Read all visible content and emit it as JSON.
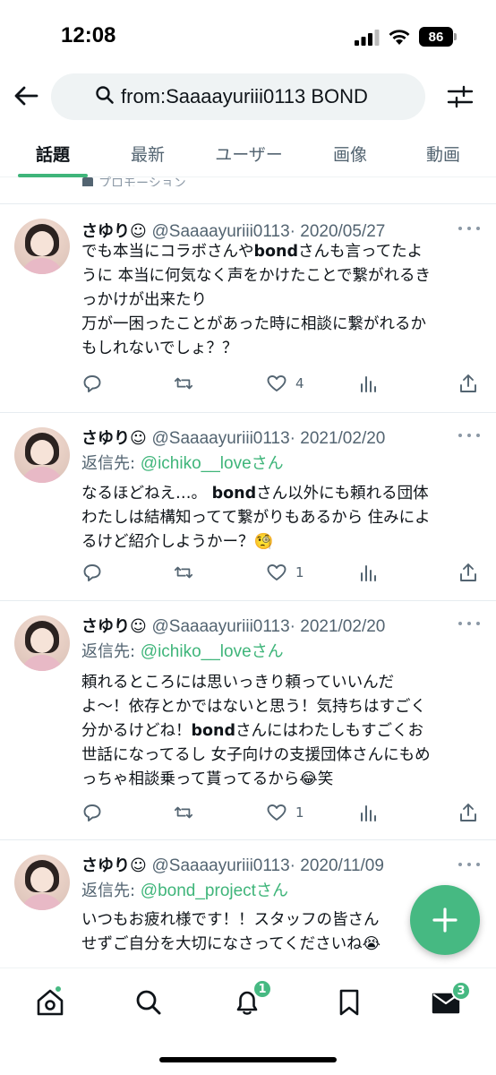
{
  "status_bar": {
    "time": "12:08",
    "battery": "86"
  },
  "search": {
    "query": "from:Saaaayuriii0113 BOND"
  },
  "tabs": [
    {
      "label": "話題",
      "active": true
    },
    {
      "label": "最新",
      "active": false
    },
    {
      "label": "ユーザー",
      "active": false
    },
    {
      "label": "画像",
      "active": false
    },
    {
      "label": "動画",
      "active": false
    }
  ],
  "promoted_label": "プロモーション",
  "tweets": [
    {
      "name": "さゆり☺︎",
      "handle": "@Saaaayuriii0113",
      "date": "· 2020/05/27",
      "reply_prefix": "",
      "reply_to": "",
      "reply_suffix": "",
      "lines": [
        [
          "でも本当にコラボさんや",
          "bond",
          "さんも言ってたよ"
        ],
        [
          "うに 本当に何気なく声をかけたことで繋がれるき"
        ],
        [
          "っかけが出来たり"
        ],
        [
          "万が一困ったことがあった時に相談に繋がれるか"
        ],
        [
          "もしれないでしょ？？"
        ]
      ],
      "likes": "4"
    },
    {
      "name": "さゆり☺︎",
      "handle": "@Saaaayuriii0113",
      "date": "· 2021/02/20",
      "reply_prefix": "返信先: ",
      "reply_to": "@ichiko__love",
      "reply_suffix": "さん",
      "lines": [
        [
          "なるほどねえ…。 ",
          "bond",
          "さん以外にも頼れる団体"
        ],
        [
          "わたしは結構知ってて繋がりもあるから 住みによ"
        ],
        [
          "るけど紹介しようかー？🧐"
        ]
      ],
      "likes": "1"
    },
    {
      "name": "さゆり☺︎",
      "handle": "@Saaaayuriii0113",
      "date": "· 2021/02/20",
      "reply_prefix": "返信先: ",
      "reply_to": "@ichiko__love",
      "reply_suffix": "さん",
      "lines": [
        [
          "頼れるところには思いっきり頼っていいんだ"
        ],
        [
          "よ〜！依存とかではないと思う！気持ちはすごく"
        ],
        [
          "分かるけどね！",
          "bond",
          "さんにはわたしもすごくお"
        ],
        [
          "世話になってるし 女子向けの支援団体さんにもめ"
        ],
        [
          "っちゃ相談乗って貰ってるから😂笑"
        ]
      ],
      "likes": "1"
    },
    {
      "name": "さゆり☺︎",
      "handle": "@Saaaayuriii0113",
      "date": "· 2020/11/09",
      "reply_prefix": "返信先: ",
      "reply_to": "@bond_project",
      "reply_suffix": "さん",
      "lines": [
        [
          "いつもお疲れ様です！！スタッフの皆さん"
        ],
        [
          "せずご自分を大切になさってくださいね😭"
        ]
      ],
      "likes": ""
    }
  ],
  "bottom_nav": {
    "notifications_badge": "1",
    "messages_badge": "3"
  },
  "colors": {
    "accent": "#3fb57a",
    "fab": "#46b982",
    "muted": "#536471"
  }
}
